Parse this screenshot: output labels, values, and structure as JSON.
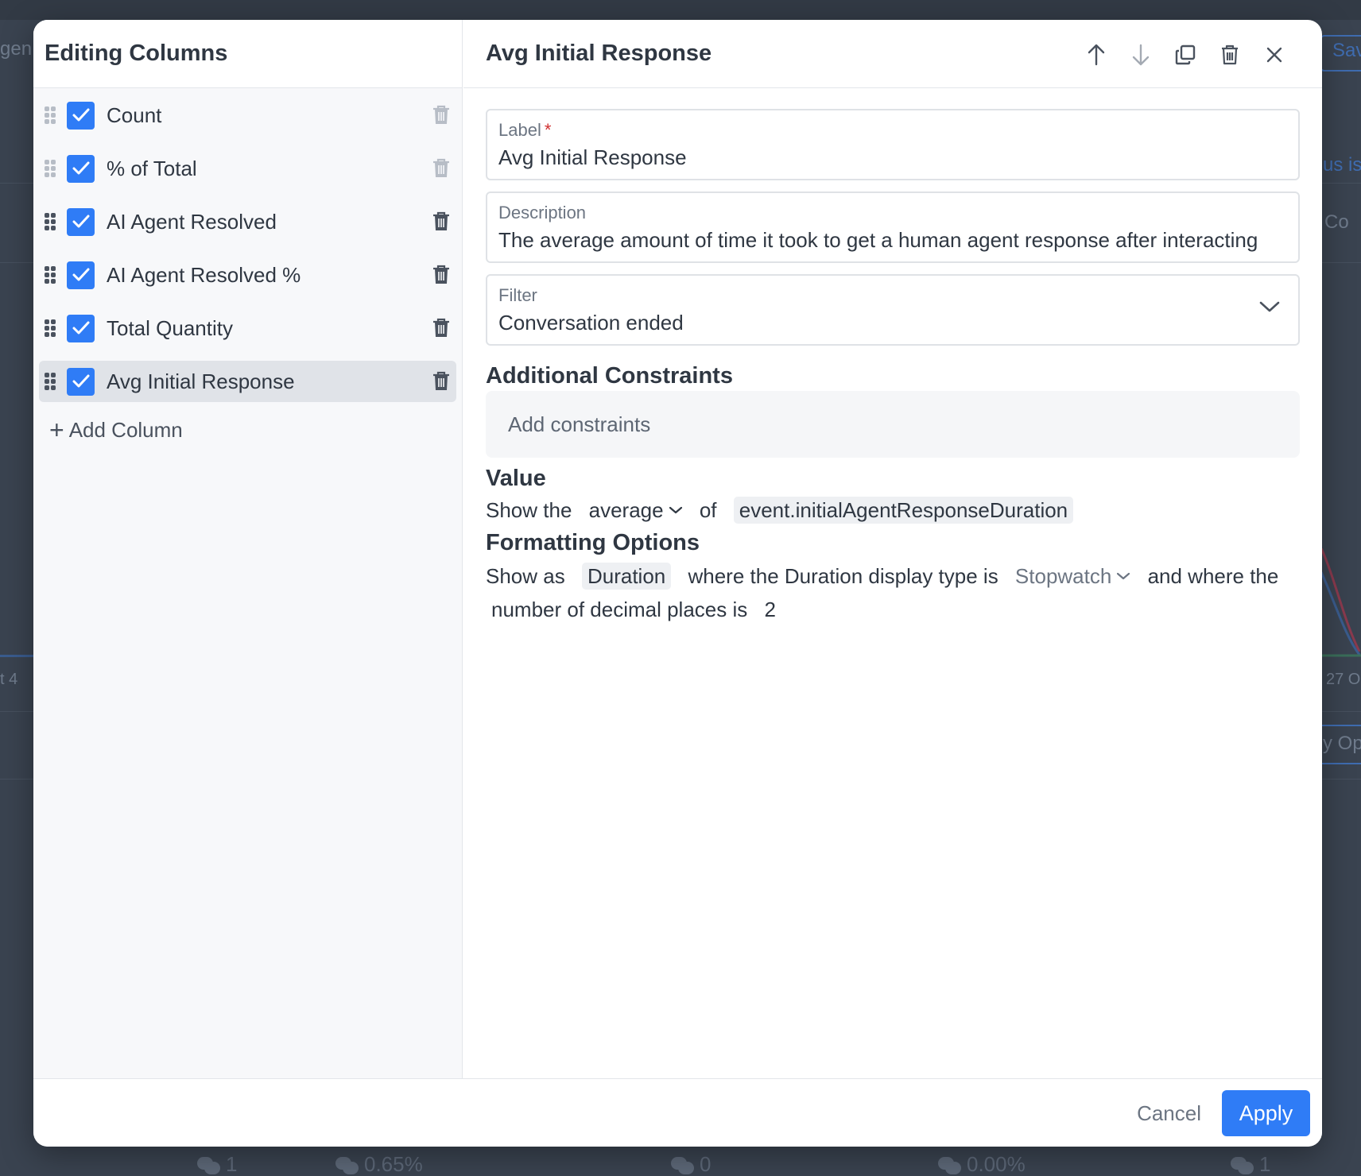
{
  "background": {
    "fragments": {
      "top_left": "gen",
      "top_right_button": "Sav",
      "right_link": "us is",
      "right_check_label": "Co",
      "axis_left": "t 4",
      "axis_right": "27 O",
      "options_button": "y Op"
    },
    "stats": [
      {
        "value": "1"
      },
      {
        "value": "0.65%"
      },
      {
        "value": "0"
      },
      {
        "value": "0.00%"
      },
      {
        "value": "1"
      }
    ]
  },
  "left": {
    "title": "Editing Columns",
    "columns": [
      {
        "label": "Count",
        "checked": true,
        "enabled": false
      },
      {
        "label": "% of Total",
        "checked": true,
        "enabled": false
      },
      {
        "label": "AI Agent Resolved",
        "checked": true,
        "enabled": true
      },
      {
        "label": "AI Agent Resolved %",
        "checked": true,
        "enabled": true
      },
      {
        "label": "Total Quantity",
        "checked": true,
        "enabled": true
      },
      {
        "label": "Avg Initial Response",
        "checked": true,
        "enabled": true,
        "selected": true
      }
    ],
    "add_column_label": "Add Column"
  },
  "right": {
    "title": "Avg Initial Response",
    "header_icons": [
      "arrow-up-icon",
      "arrow-down-icon",
      "duplicate-icon",
      "trash-icon",
      "close-icon"
    ],
    "label_field": {
      "label": "Label",
      "required_mark": "*",
      "value": "Avg Initial Response"
    },
    "description_field": {
      "label": "Description",
      "value": "The average amount of time it took to get a human agent response after interacting"
    },
    "filter_field": {
      "label": "Filter",
      "value": "Conversation ended"
    },
    "constraints": {
      "title": "Additional Constraints",
      "placeholder": "Add constraints"
    },
    "value_section": {
      "title": "Value",
      "prefix": "Show the",
      "aggregation": "average",
      "connector": "of",
      "field": "event.initialAgentResponseDuration"
    },
    "formatting": {
      "title": "Formatting Options",
      "prefix": "Show as",
      "format": "Duration",
      "middle": "where the Duration display type is",
      "display_type": "Stopwatch",
      "suffix": "and where the",
      "decimal_text": "number of decimal places is",
      "decimal_places": "2"
    }
  },
  "footer": {
    "cancel_label": "Cancel",
    "apply_label": "Apply"
  },
  "colors": {
    "accent": "#2f7cf6",
    "required": "#d03030"
  }
}
